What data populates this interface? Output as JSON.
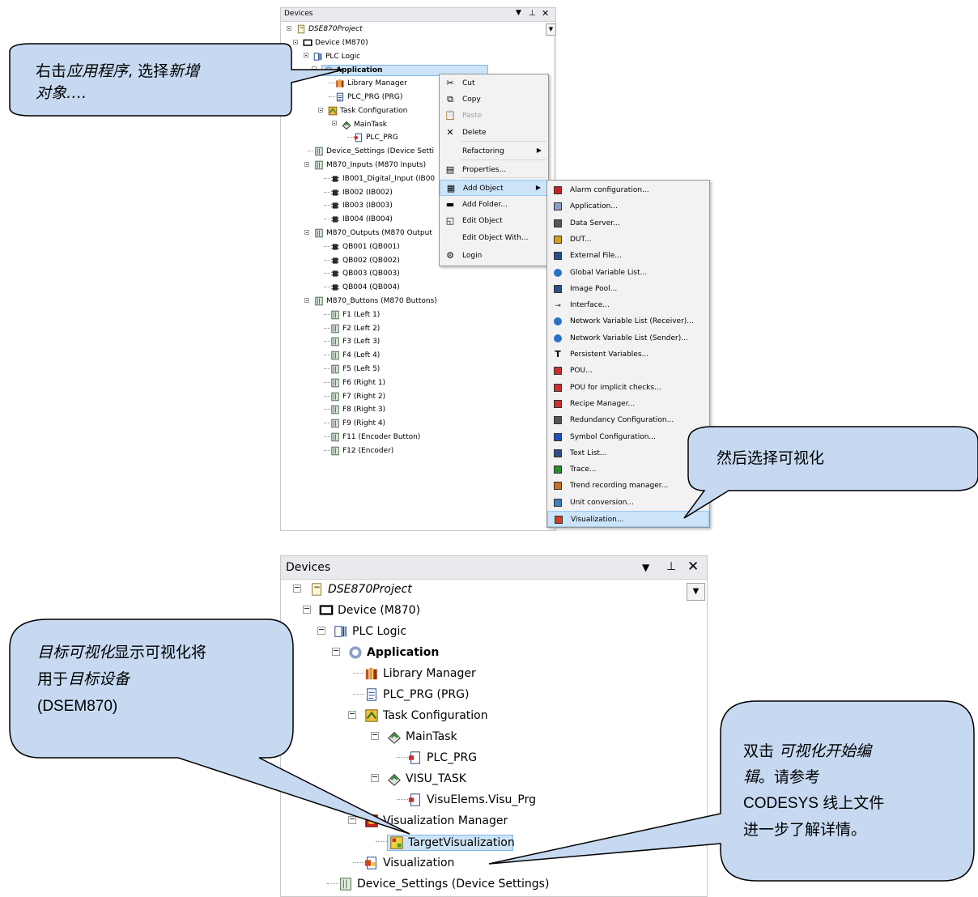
{
  "top": {
    "title": "Devices",
    "tree": [
      {
        "label": "DSE870Project",
        "italic": true
      },
      {
        "label": "Device (M870)"
      },
      {
        "label": "PLC Logic"
      },
      {
        "label": "Application",
        "bold": true
      },
      {
        "label": "Library Manager"
      },
      {
        "label": "PLC_PRG (PRG)"
      },
      {
        "label": "Task Configuration"
      },
      {
        "label": "MainTask"
      },
      {
        "label": "PLC_PRG"
      },
      {
        "label": "Device_Settings (Device Setti"
      },
      {
        "label": "M870_Inputs (M870 Inputs)"
      },
      {
        "label": "IB001_Digital_Input (IB00"
      },
      {
        "label": "IB002 (IB002)"
      },
      {
        "label": "IB003 (IB003)"
      },
      {
        "label": "IB004 (IB004)"
      },
      {
        "label": "M870_Outputs (M870 Output"
      },
      {
        "label": "QB001 (QB001)"
      },
      {
        "label": "QB002 (QB002)"
      },
      {
        "label": "QB003 (QB003)"
      },
      {
        "label": "QB004 (QB004)"
      },
      {
        "label": "M870_Buttons (M870 Buttons)"
      },
      {
        "label": "F1 (Left 1)"
      },
      {
        "label": "F2 (Left 2)"
      },
      {
        "label": "F3 (Left 3)"
      },
      {
        "label": "F4 (Left 4)"
      },
      {
        "label": "F5 (Left 5)"
      },
      {
        "label": "F6 (Right 1)"
      },
      {
        "label": "F7 (Right 2)"
      },
      {
        "label": "F8 (Right 3)"
      },
      {
        "label": "F9 (Right 4)"
      },
      {
        "label": "F11 (Encoder Button)"
      },
      {
        "label": "F12 (Encoder)"
      }
    ],
    "context_menu": [
      {
        "label": "Cut",
        "icon": "cut-icon"
      },
      {
        "label": "Copy",
        "icon": "copy-icon"
      },
      {
        "label": "Paste",
        "icon": "paste-icon",
        "disabled": true
      },
      {
        "label": "Delete",
        "icon": "delete-icon"
      },
      {
        "label": "Refactoring",
        "icon": "",
        "submenu": true
      },
      {
        "label": "Properties...",
        "icon": "properties-icon"
      },
      {
        "label": "Add Object",
        "icon": "add-object-icon",
        "submenu": true,
        "highlighted": true
      },
      {
        "label": "Add Folder...",
        "icon": "folder-icon"
      },
      {
        "label": "Edit Object",
        "icon": "edit-object-icon"
      },
      {
        "label": "Edit Object With...",
        "icon": ""
      },
      {
        "label": "Login",
        "icon": "login-icon"
      }
    ],
    "submenu": [
      {
        "label": "Alarm configuration...",
        "icon": "alarm-icon"
      },
      {
        "label": "Application...",
        "icon": "application-icon"
      },
      {
        "label": "Data Server...",
        "icon": "data-server-icon"
      },
      {
        "label": "DUT...",
        "icon": "dut-icon"
      },
      {
        "label": "External File...",
        "icon": "external-file-icon"
      },
      {
        "label": "Global Variable List...",
        "icon": "globe-icon"
      },
      {
        "label": "Image Pool...",
        "icon": "image-pool-icon"
      },
      {
        "label": "Interface...",
        "icon": "interface-icon"
      },
      {
        "label": "Network Variable List (Receiver)...",
        "icon": "globe-icon"
      },
      {
        "label": "Network Variable List (Sender)...",
        "icon": "globe-icon"
      },
      {
        "label": "Persistent Variables...",
        "icon": "persistent-icon"
      },
      {
        "label": "POU...",
        "icon": "pou-icon"
      },
      {
        "label": "POU for implicit checks...",
        "icon": "pou-icon"
      },
      {
        "label": "Recipe Manager...",
        "icon": "recipe-icon"
      },
      {
        "label": "Redundancy Configuration...",
        "icon": "redundancy-icon"
      },
      {
        "label": "Symbol Configuration...",
        "icon": "symbol-icon"
      },
      {
        "label": "Text List...",
        "icon": "text-list-icon"
      },
      {
        "label": "Trace...",
        "icon": "trace-icon"
      },
      {
        "label": "Trend recording manager...",
        "icon": "trend-icon"
      },
      {
        "label": "Unit conversion...",
        "icon": "unit-conversion-icon"
      },
      {
        "label": "Visualization...",
        "icon": "visualization-icon",
        "highlighted": true
      }
    ]
  },
  "bottom": {
    "title": "Devices",
    "tree": [
      {
        "label": "DSE870Project",
        "italic": true
      },
      {
        "label": "Device (M870)"
      },
      {
        "label": "PLC Logic"
      },
      {
        "label": "Application",
        "bold": true
      },
      {
        "label": "Library Manager"
      },
      {
        "label": "PLC_PRG (PRG)"
      },
      {
        "label": "Task Configuration"
      },
      {
        "label": "MainTask"
      },
      {
        "label": "PLC_PRG"
      },
      {
        "label": "VISU_TASK"
      },
      {
        "label": "VisuElems.Visu_Prg"
      },
      {
        "label": "Visualization Manager"
      },
      {
        "label": "TargetVisualization"
      },
      {
        "label": "Visualization"
      },
      {
        "label": "Device_Settings (Device Settings)"
      }
    ]
  },
  "callouts": {
    "c1_a": "右击",
    "c1_b": "应用程序",
    "c1_c": ", 选择",
    "c1_d": "新增",
    "c1_e": "对象….",
    "c2": "然后选择可视化",
    "c3_a": "目标可视化",
    "c3_b": "显示可视化将",
    "c3_c": "用于",
    "c3_d": "目标设备",
    "c3_e": "(DSEM870)",
    "c4_a": "双击 ",
    "c4_b": "可视化开始编",
    "c4_c": "辑",
    "c4_d": "。请参考",
    "c4_e": "CODESYS 线上文件",
    "c4_f": "进一步了解详情。"
  },
  "colors": {
    "bubble_fill": "#c6d9f1",
    "bubble_stroke": "#000000",
    "highlight": "#cce4f7"
  }
}
